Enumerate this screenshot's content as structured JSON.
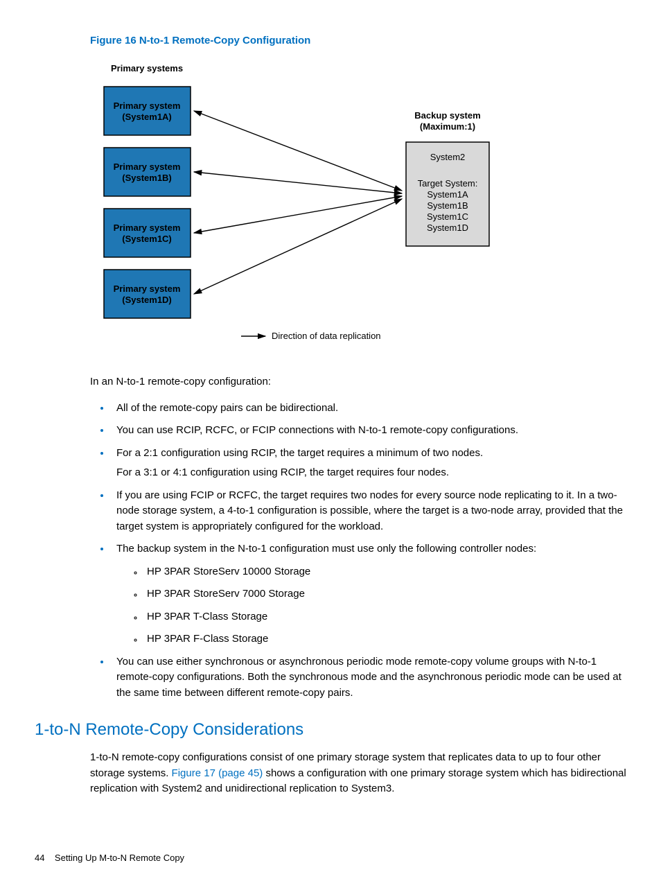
{
  "figure": {
    "caption": "Figure 16 N-to-1 Remote-Copy Configuration",
    "labels": {
      "primary_header": "Primary systems",
      "backup_header_line1": "Backup system",
      "backup_header_line2": "(Maximum:1)",
      "box_a_line1": "Primary system",
      "box_a_line2": "(System1A)",
      "box_b_line1": "Primary system",
      "box_b_line2": "(System1B)",
      "box_c_line1": "Primary system",
      "box_c_line2": "(System1C)",
      "box_d_line1": "Primary system",
      "box_d_line2": "(System1D)",
      "target_l1": "System2",
      "target_l2": "Target System:",
      "target_l3": "System1A",
      "target_l4": "System1B",
      "target_l5": "System1C",
      "target_l6": "System1D",
      "legend": "Direction of data replication"
    }
  },
  "intro": "In an N-to-1 remote-copy configuration:",
  "bullets": {
    "b1": "All of the remote-copy pairs can be bidirectional.",
    "b2": "You can use RCIP, RCFC, or FCIP connections with N-to-1 remote-copy configurations.",
    "b3a": "For a 2:1 configuration using RCIP, the target requires a minimum of two nodes.",
    "b3b": "For a 3:1 or 4:1 configuration using RCIP, the target requires four nodes.",
    "b4": "If you are using FCIP or RCFC, the target requires two nodes for every source node replicating to it. In a two-node storage system, a 4-to-1 configuration is possible, where the target is a two-node array, provided that the target system is appropriately configured for the workload.",
    "b5": "The backup system in the N-to-1 configuration must use only the following controller nodes:",
    "b5s1": "HP 3PAR StoreServ 10000 Storage",
    "b5s2": "HP 3PAR StoreServ 7000 Storage",
    "b5s3": "HP 3PAR T-Class Storage",
    "b5s4": "HP 3PAR F-Class Storage",
    "b6": "You can use either synchronous or asynchronous periodic mode remote-copy volume groups with N-to-1 remote-copy configurations. Both the synchronous mode and the asynchronous periodic mode can be used at the same time between different remote-copy pairs."
  },
  "section": {
    "heading": "1-to-N Remote-Copy Considerations",
    "para_before": "1-to-N remote-copy configurations consist of one primary storage system that replicates data to up to four other storage systems. ",
    "xref": "Figure 17 (page 45)",
    "para_after": " shows a configuration with one primary storage system which has bidirectional replication with System2 and unidirectional replication to System3."
  },
  "footer": {
    "page_num": "44",
    "section_title": "Setting Up M-to-N Remote Copy"
  }
}
